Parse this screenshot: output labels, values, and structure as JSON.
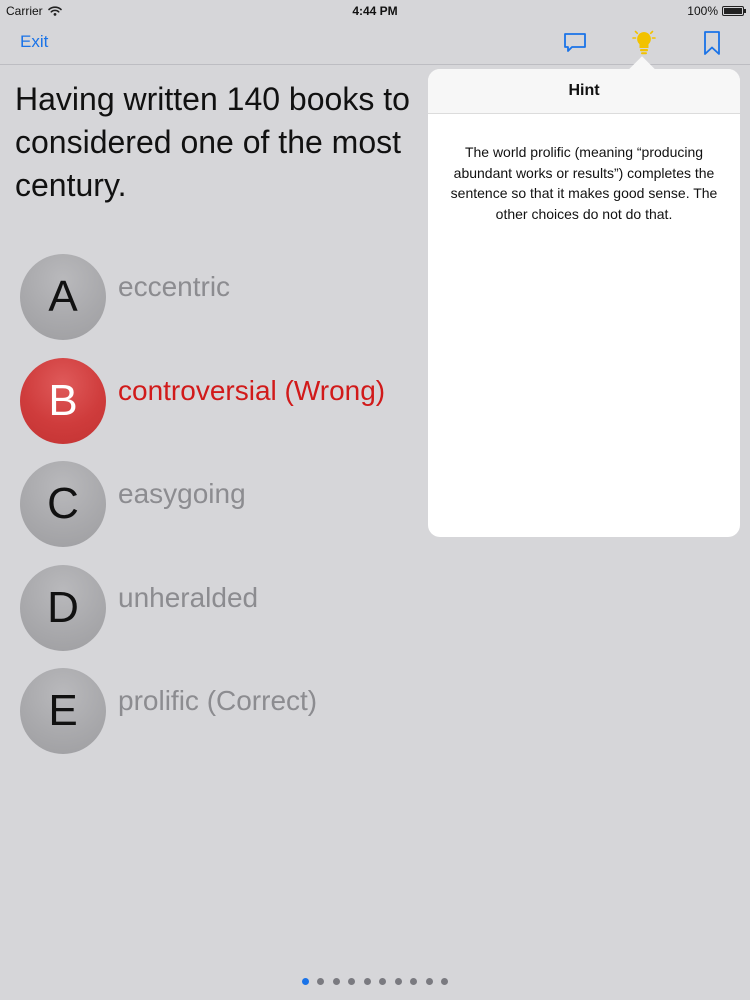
{
  "status_bar": {
    "carrier": "Carrier",
    "time": "4:44 PM",
    "battery": "100%",
    "battery_level": 1.0
  },
  "nav": {
    "exit_label": "Exit",
    "icons": [
      "comment-icon",
      "lightbulb-icon",
      "bookmark-icon"
    ]
  },
  "question": {
    "visible_lines": [
      "Having written 140 books to",
      "considered one of the most",
      "century."
    ]
  },
  "answers": [
    {
      "letter": "A",
      "text": "eccentric",
      "state": "neutral"
    },
    {
      "letter": "B",
      "text": "controversial (Wrong)",
      "state": "wrong"
    },
    {
      "letter": "C",
      "text": "easygoing",
      "state": "neutral"
    },
    {
      "letter": "D",
      "text": "unheralded",
      "state": "neutral"
    },
    {
      "letter": "E",
      "text": "prolific (Correct)",
      "state": "neutral"
    }
  ],
  "hint": {
    "title": "Hint",
    "body_lines": [
      "The world prolific (meaning “producing",
      "abundant works or results”) completes the",
      "sentence so that it makes good sense. The",
      "other choices do not do that."
    ]
  },
  "pagination": {
    "total": 10,
    "current": 1
  },
  "colors": {
    "accent": "#1a73e8",
    "wrong": "#d11a1a",
    "wrong_circle": "#cf3c3c",
    "neutral_circle": "#a9a9ac",
    "lightbulb": "#f2c200",
    "background": "#d6d6d9"
  }
}
